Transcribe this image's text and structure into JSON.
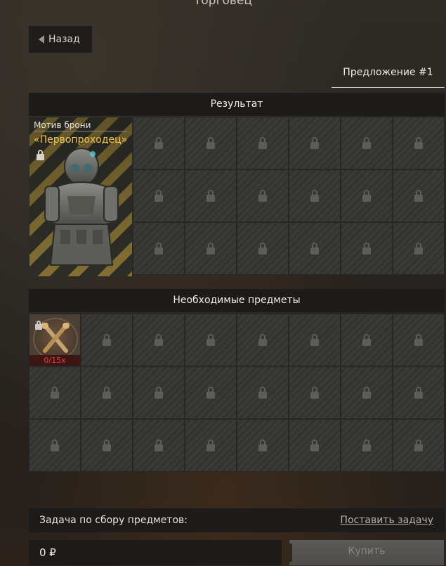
{
  "window": {
    "title": "Торговец"
  },
  "nav": {
    "back_label": "Назад"
  },
  "offer_tab": {
    "label": "Предложение #1"
  },
  "result": {
    "header": "Результат",
    "item": {
      "type": "Мотив брони",
      "name": "«Первопроходец»",
      "icon": "armor-suit-icon",
      "stripe_color": "#bfa044",
      "name_color": "#f2c94c"
    }
  },
  "required": {
    "header": "Необходимые предметы",
    "items": [
      {
        "icon": "crossed-tools-icon",
        "count": "0/15x",
        "count_color": "#e0453a"
      }
    ]
  },
  "task": {
    "label": "Задача по сбору предметов:",
    "link": "Поставить задачу"
  },
  "price": {
    "value": "0 ₽"
  },
  "buy": {
    "label": "Купить"
  }
}
